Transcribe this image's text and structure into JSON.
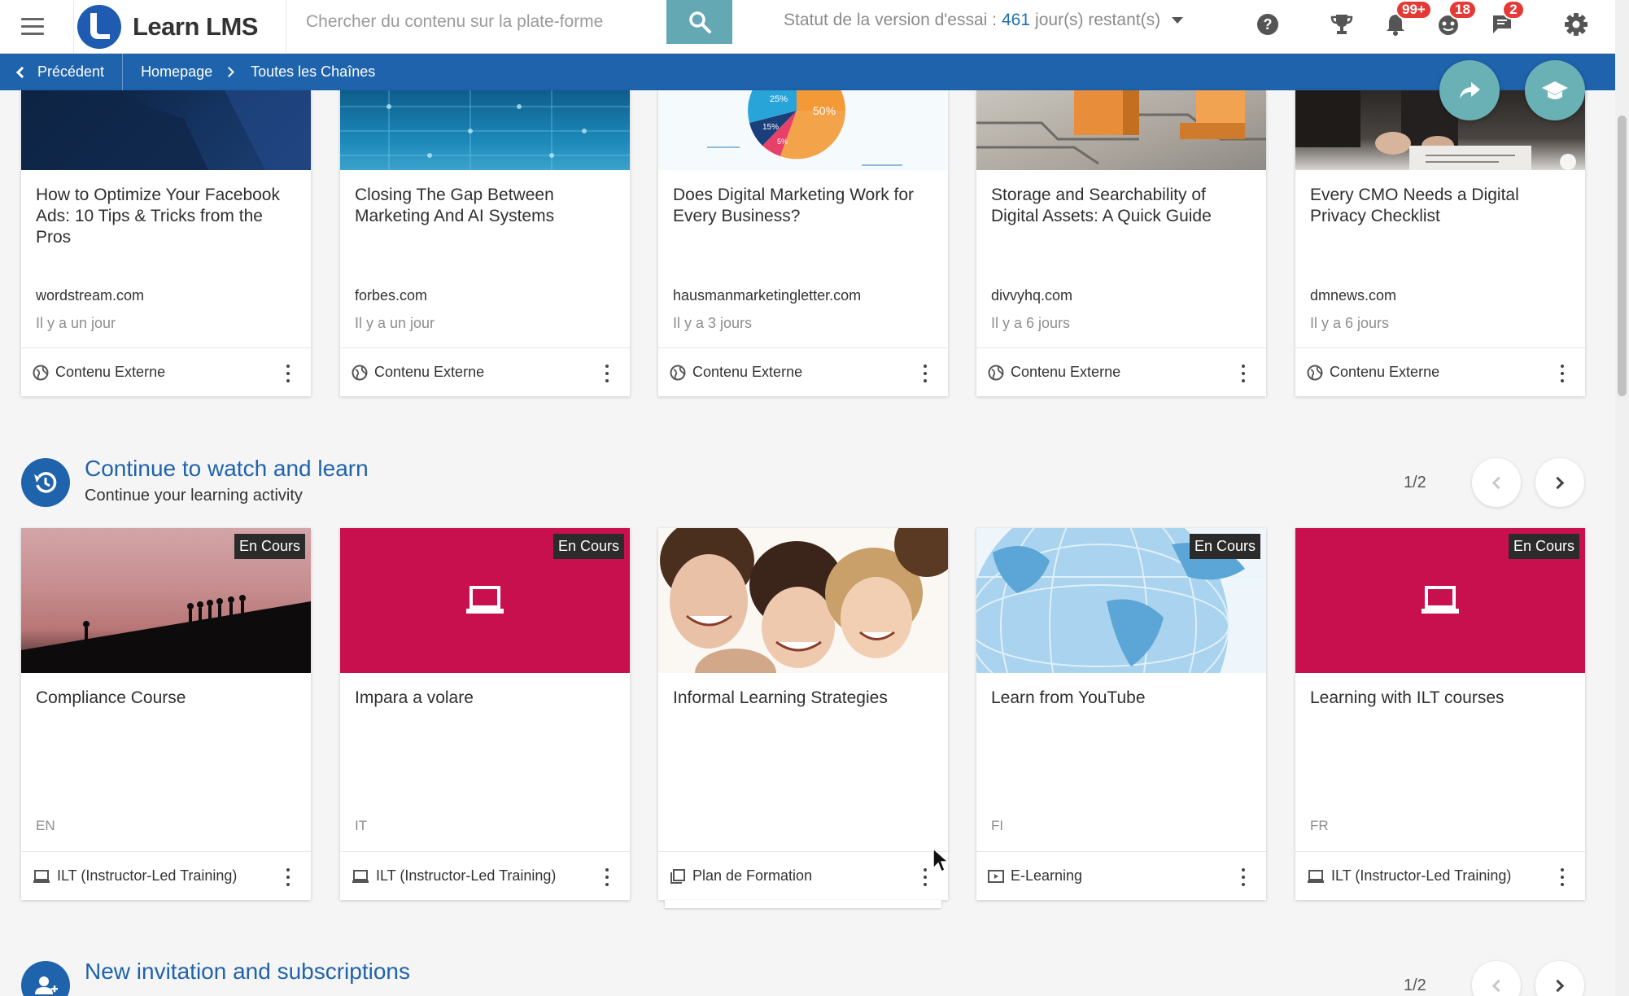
{
  "header": {
    "app_name": "Learn LMS",
    "search_placeholder": "Chercher du contenu sur la plate-forme",
    "trial_label": "Statut de la version d'essai :",
    "trial_days": "461",
    "trial_suffix": "jour(s) restant(s)",
    "badges": {
      "notifications": "99+",
      "tasks": "18",
      "messages": "2"
    }
  },
  "breadcrumb": {
    "back_label": "Précédent",
    "items": [
      "Homepage",
      "Toutes les Chaînes"
    ]
  },
  "external_cards": [
    {
      "title": "How to Optimize Your Facebook Ads: 10 Tips & Tricks from the Pros",
      "source": "wordstream.com",
      "time": "Il y a un jour",
      "type": "Contenu Externe"
    },
    {
      "title": "Closing The Gap Between Marketing And AI Systems",
      "source": "forbes.com",
      "time": "Il y a un jour",
      "type": "Contenu Externe"
    },
    {
      "title": "Does Digital Marketing Work for Every Business?",
      "source": "hausmanmarketingletter.com",
      "time": "Il y a 3 jours",
      "type": "Contenu Externe",
      "pie_labels": [
        "25%",
        "50%",
        "15%",
        "5%"
      ]
    },
    {
      "title": "Storage and Searchability of Digital Assets: A Quick Guide",
      "source": "divvyhq.com",
      "time": "Il y a 6 jours",
      "type": "Contenu Externe"
    },
    {
      "title": "Every CMO Needs a Digital Privacy Checklist",
      "source": "dmnews.com",
      "time": "Il y a 6 jours",
      "type": "Contenu Externe"
    }
  ],
  "continue_section": {
    "title": "Continue to watch and learn",
    "subtitle": "Continue your learning activity",
    "pager": "1/2"
  },
  "course_cards": [
    {
      "title": "Compliance Course",
      "lang": "EN",
      "type": "ILT (Instructor-Led Training)",
      "status": "En Cours"
    },
    {
      "title": "Impara a volare",
      "lang": "IT",
      "type": "ILT (Instructor-Led Training)",
      "status": "En Cours"
    },
    {
      "title": "Informal Learning Strategies",
      "lang": "",
      "type": "Plan de Formation",
      "status": ""
    },
    {
      "title": "Learn from YouTube",
      "lang": "FI",
      "type": "E-Learning",
      "status": "En Cours"
    },
    {
      "title": "Learning with ILT courses",
      "lang": "FR",
      "type": "ILT (Instructor-Led Training)",
      "status": "En Cours"
    }
  ],
  "invitation_section": {
    "title": "New invitation and subscriptions",
    "pager": "1/2"
  },
  "colors": {
    "brand_blue": "#1f63ad",
    "search_button": "#63a8b3",
    "fab": "#6ab1b6",
    "ilt_tile": "#c8104e",
    "badge_red": "#e53935"
  },
  "icons": [
    "menu-icon",
    "search-icon",
    "help-icon",
    "trophy-icon",
    "bell-icon",
    "tasks-icon",
    "chat-icon",
    "gear-icon",
    "share-icon",
    "graduation-cap-icon",
    "globe-icon",
    "history-icon",
    "laptop-icon",
    "learning-plan-icon",
    "video-icon",
    "add-user-icon",
    "more-vert-icon"
  ]
}
